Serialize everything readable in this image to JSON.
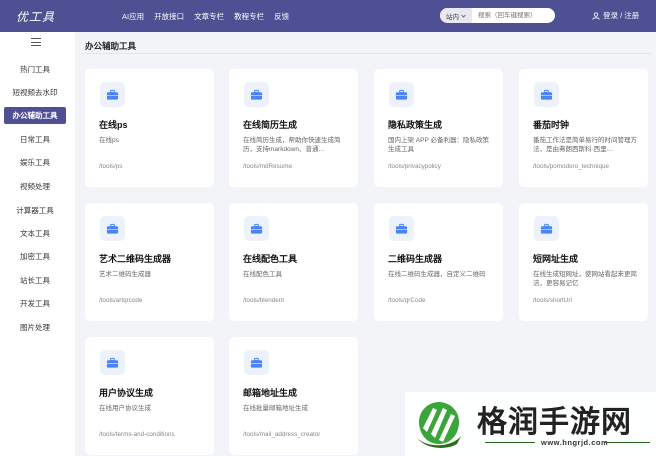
{
  "header": {
    "logo_text": "优工具",
    "nav": [
      "AI应用",
      "开放接口",
      "文章专栏",
      "教程专栏",
      "反馈"
    ],
    "search_scope": "站内",
    "search_placeholder": "搜索（回车键搜索）",
    "user_link": "登录 / 注册"
  },
  "sidebar": {
    "items": [
      "热门工具",
      "短视频去水印",
      "办公辅助工具",
      "日常工具",
      "娱乐工具",
      "视频处理",
      "计算器工具",
      "文本工具",
      "加密工具",
      "站长工具",
      "开发工具",
      "图片处理"
    ],
    "active_index": 2
  },
  "main": {
    "section_title": "办公辅助工具",
    "cards": [
      {
        "name": "在线ps",
        "desc": "在线ps",
        "path": "/tools/ps"
      },
      {
        "name": "在线简历生成",
        "desc": "在线简历生成，帮助你快速生成简历，支持markdown、普通…",
        "path": "/tools/mdResume"
      },
      {
        "name": "隐私政策生成",
        "desc": "国内上架 APP 必备利器：隐私政策生成工具",
        "path": "/tools/privacypolicy"
      },
      {
        "name": "番茄时钟",
        "desc": "番茄工作法是简单易行的时间管理方法，是由弗朗西斯科·西里…",
        "path": "/tools/pomodoro_technique"
      },
      {
        "name": "艺术二维码生成器",
        "desc": "艺术二维码生成器",
        "path": "/tools/artqrcode"
      },
      {
        "name": "在线配色工具",
        "desc": "在线配色工具",
        "path": "/tools/blendent"
      },
      {
        "name": "二维码生成器",
        "desc": "在线二维码生成器，自定义二维码",
        "path": "/tools/qrCode"
      },
      {
        "name": "短网址生成",
        "desc": "在线生成短网址，使网站看起来更简洁，更容易记忆",
        "path": "/tools/shortUrl"
      },
      {
        "name": "用户协议生成",
        "desc": "在线用户协议生成",
        "path": "/tools/terms-and-conditions"
      },
      {
        "name": "邮箱地址生成",
        "desc": "在线批量邮箱地址生成",
        "path": "/tools/mail_address_creator"
      }
    ]
  },
  "watermark": {
    "title": "格润手游网",
    "url": "www.hngrjd.com"
  },
  "colors": {
    "header_bg": "#4f4f93",
    "accent": "#4f4f93",
    "icon_blue": "#4a84f7",
    "page_bg": "#f3f4f8"
  }
}
